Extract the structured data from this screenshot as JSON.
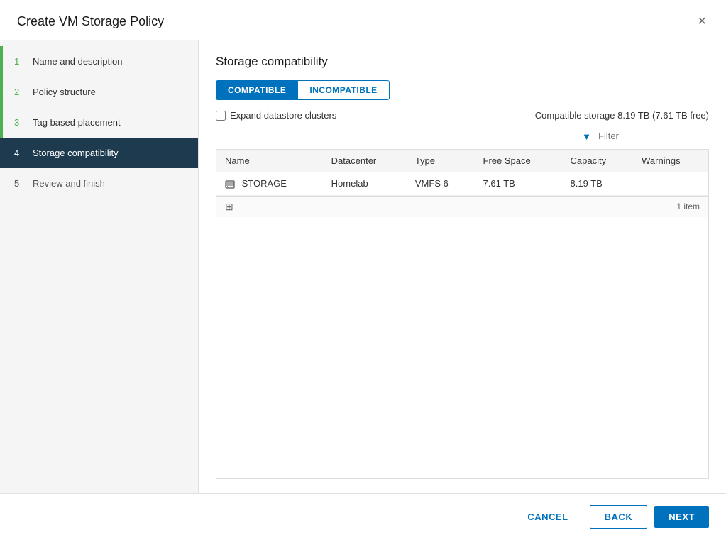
{
  "modal": {
    "title": "Create VM Storage Policy",
    "close_label": "×"
  },
  "sidebar": {
    "items": [
      {
        "step": "1",
        "label": "Name and description",
        "state": "completed"
      },
      {
        "step": "2",
        "label": "Policy structure",
        "state": "completed"
      },
      {
        "step": "3",
        "label": "Tag based placement",
        "state": "completed"
      },
      {
        "step": "4",
        "label": "Storage compatibility",
        "state": "active"
      },
      {
        "step": "5",
        "label": "Review and finish",
        "state": "inactive"
      }
    ]
  },
  "main": {
    "section_title": "Storage compatibility",
    "tabs": [
      {
        "label": "COMPATIBLE",
        "active": true
      },
      {
        "label": "INCOMPATIBLE",
        "active": false
      }
    ],
    "expand_label": "Expand datastore clusters",
    "compatible_storage_text": "Compatible storage 8.19 TB (7.61 TB free)",
    "filter_placeholder": "Filter",
    "table": {
      "columns": [
        "Name",
        "Datacenter",
        "Type",
        "Free Space",
        "Capacity",
        "Warnings"
      ],
      "rows": [
        {
          "name": "STORAGE",
          "datacenter": "Homelab",
          "type": "VMFS 6",
          "free_space": "7.61 TB",
          "capacity": "8.19 TB",
          "warnings": ""
        }
      ]
    },
    "footer_item_count": "1 item"
  },
  "footer": {
    "cancel_label": "CANCEL",
    "back_label": "BACK",
    "next_label": "NEXT"
  }
}
